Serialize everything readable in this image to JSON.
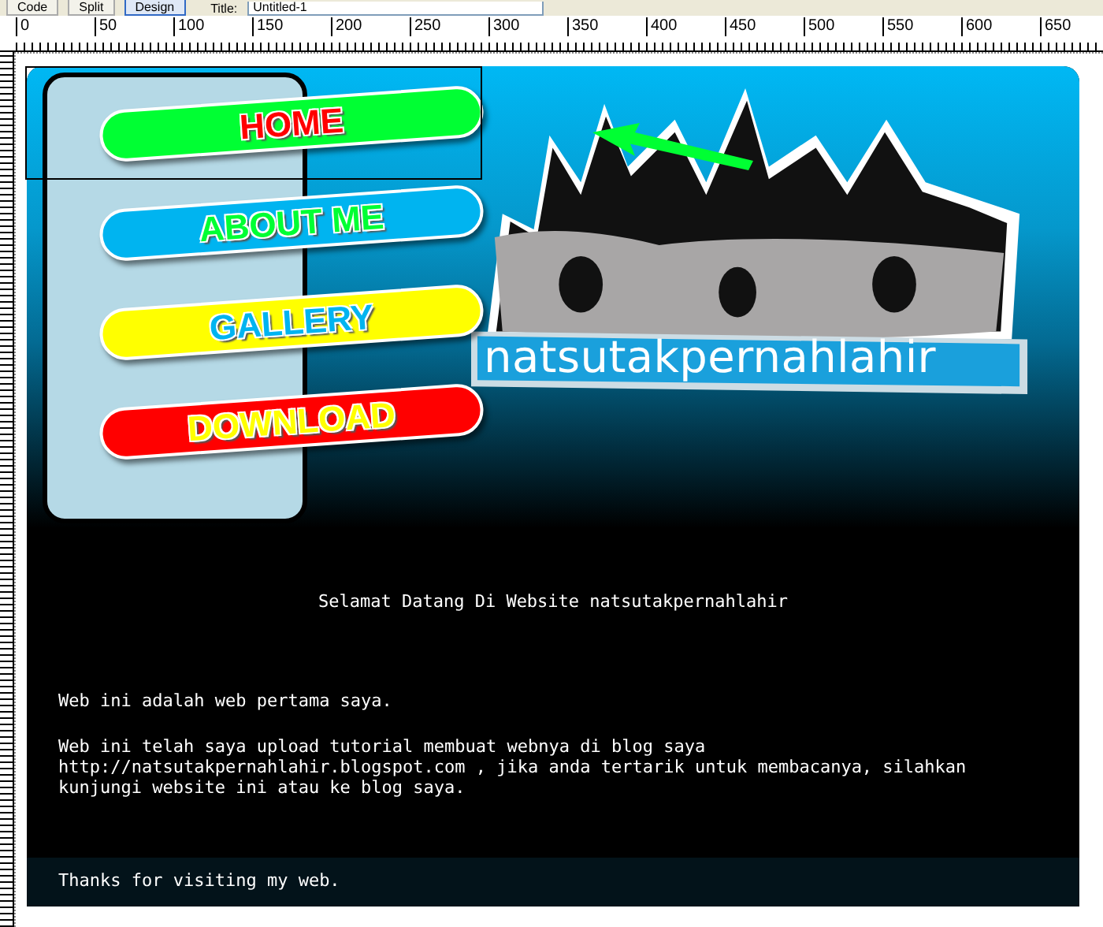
{
  "toolbar": {
    "buttons": [
      {
        "label": "Code",
        "selected": false
      },
      {
        "label": "Split",
        "selected": false
      },
      {
        "label": "Design",
        "selected": true
      }
    ],
    "title_label": "Title:",
    "title_value": "Untitled-1"
  },
  "ruler": {
    "labels": [
      "0",
      "50",
      "100",
      "150",
      "200",
      "250",
      "300",
      "350",
      "400",
      "450",
      "500",
      "550",
      "600",
      "650"
    ]
  },
  "header": {
    "nav": [
      {
        "label": "HOME",
        "color": "#00ff33"
      },
      {
        "label": "ABOUT ME",
        "color": "#00b4f0"
      },
      {
        "label": "GALLERY",
        "color": "#ffff00"
      },
      {
        "label": "DOWNLOAD",
        "color": "#ff0000"
      }
    ],
    "banner_subtitle": "natsutakpernahlahir"
  },
  "content": {
    "welcome": "Selamat Datang Di Website natsutakpernahlahir",
    "paragraphs": [
      "Web ini adalah web pertama saya.",
      "Web ini telah saya upload tutorial membuat webnya di blog saya http://natsutakpernahlahir.blogspot.com , jika anda tertarik untuk membacanya, silahkan kunjungi website ini atau ke blog saya."
    ],
    "footer": "Thanks for visiting my web."
  }
}
